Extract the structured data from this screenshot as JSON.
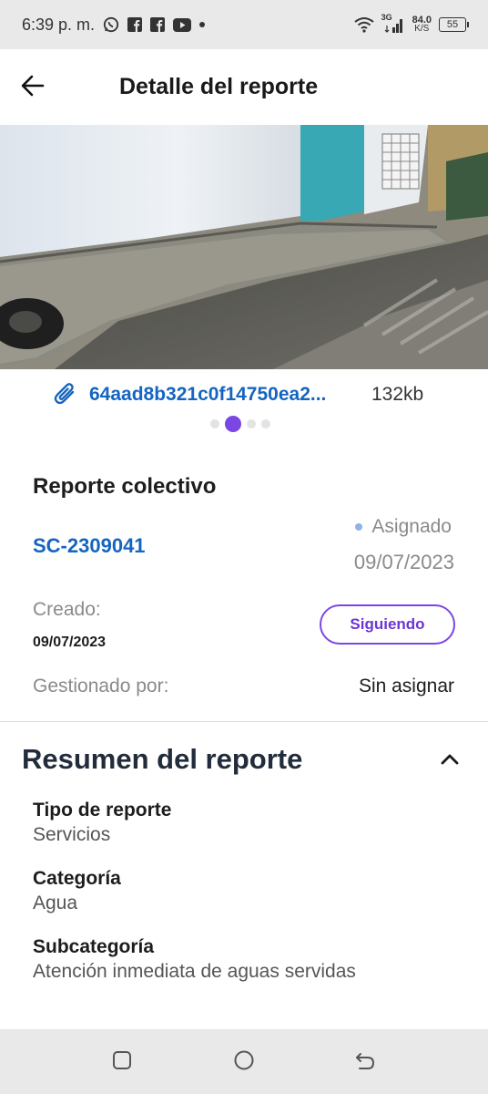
{
  "status_bar": {
    "time": "6:39 p. m.",
    "network_type": "3G",
    "speed_value": "84.0",
    "speed_unit": "K/S",
    "battery": "55",
    "notification_icons": [
      "whatsapp-icon",
      "facebook-icon",
      "facebook-icon",
      "youtube-icon",
      "dot-icon"
    ]
  },
  "header": {
    "title": "Detalle del reporte"
  },
  "attachment": {
    "file_name": "64aad8b321c0f14750ea2...",
    "file_size": "132kb"
  },
  "carousel": {
    "total": 4,
    "active_index": 1
  },
  "report": {
    "type": "Reporte colectivo",
    "code": "SC-2309041",
    "status": "Asignado",
    "status_date": "09/07/2023",
    "created_label": "Creado:",
    "created_date": "09/07/2023",
    "follow_button": "Siguiendo",
    "managed_label": "Gestionado por:",
    "managed_value": "Sin asignar"
  },
  "summary": {
    "title": "Resumen del reporte",
    "fields": [
      {
        "label": "Tipo de reporte",
        "value": "Servicios"
      },
      {
        "label": "Categoría",
        "value": "Agua"
      },
      {
        "label": "Subcategoría",
        "value": "Atención inmediata de aguas servidas"
      }
    ]
  },
  "colors": {
    "accent": "#7b47e3",
    "link": "#1565c0",
    "status_dot": "#90b3e6"
  }
}
